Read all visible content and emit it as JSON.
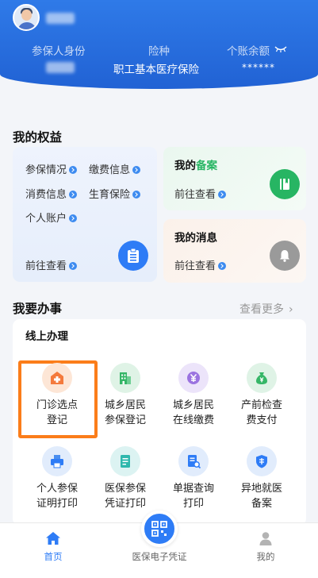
{
  "header": {
    "insured_identity_label": "参保人身份",
    "insurance_type_label": "险种",
    "insurance_type_value": "职工基本医疗保险",
    "account_balance_label": "个账余额",
    "account_balance_value": "******"
  },
  "rights": {
    "title": "我的权益",
    "links": [
      "参保情况",
      "缴费信息",
      "消费信息",
      "生育保险",
      "个人账户"
    ],
    "go_view": "前往查看"
  },
  "filing": {
    "title_prefix": "我的",
    "title_highlight": "备案",
    "go_view": "前往查看"
  },
  "messages": {
    "title": "我的消息",
    "go_view": "前往查看"
  },
  "services": {
    "title": "我要办事",
    "more_label": "查看更多",
    "online_title": "线上办理",
    "items": [
      {
        "line1": "门诊选点",
        "line2": "登记"
      },
      {
        "line1": "城乡居民",
        "line2": "参保登记"
      },
      {
        "line1": "城乡居民",
        "line2": "在线缴费"
      },
      {
        "line1": "产前检查",
        "line2": "费支付"
      },
      {
        "line1": "个人参保",
        "line2": "证明打印"
      },
      {
        "line1": "医保参保",
        "line2": "凭证打印"
      },
      {
        "line1": "单据查询",
        "line2": "打印"
      },
      {
        "line1": "异地就医",
        "line2": "备案"
      }
    ]
  },
  "tabbar": {
    "home": "首页",
    "ecert": "医保电子凭证",
    "mine": "我的"
  },
  "colors": {
    "header_blue": "#2162d4",
    "accent_blue": "#2e7cf6",
    "green": "#27b563",
    "highlight_orange": "#fb7d1a"
  }
}
